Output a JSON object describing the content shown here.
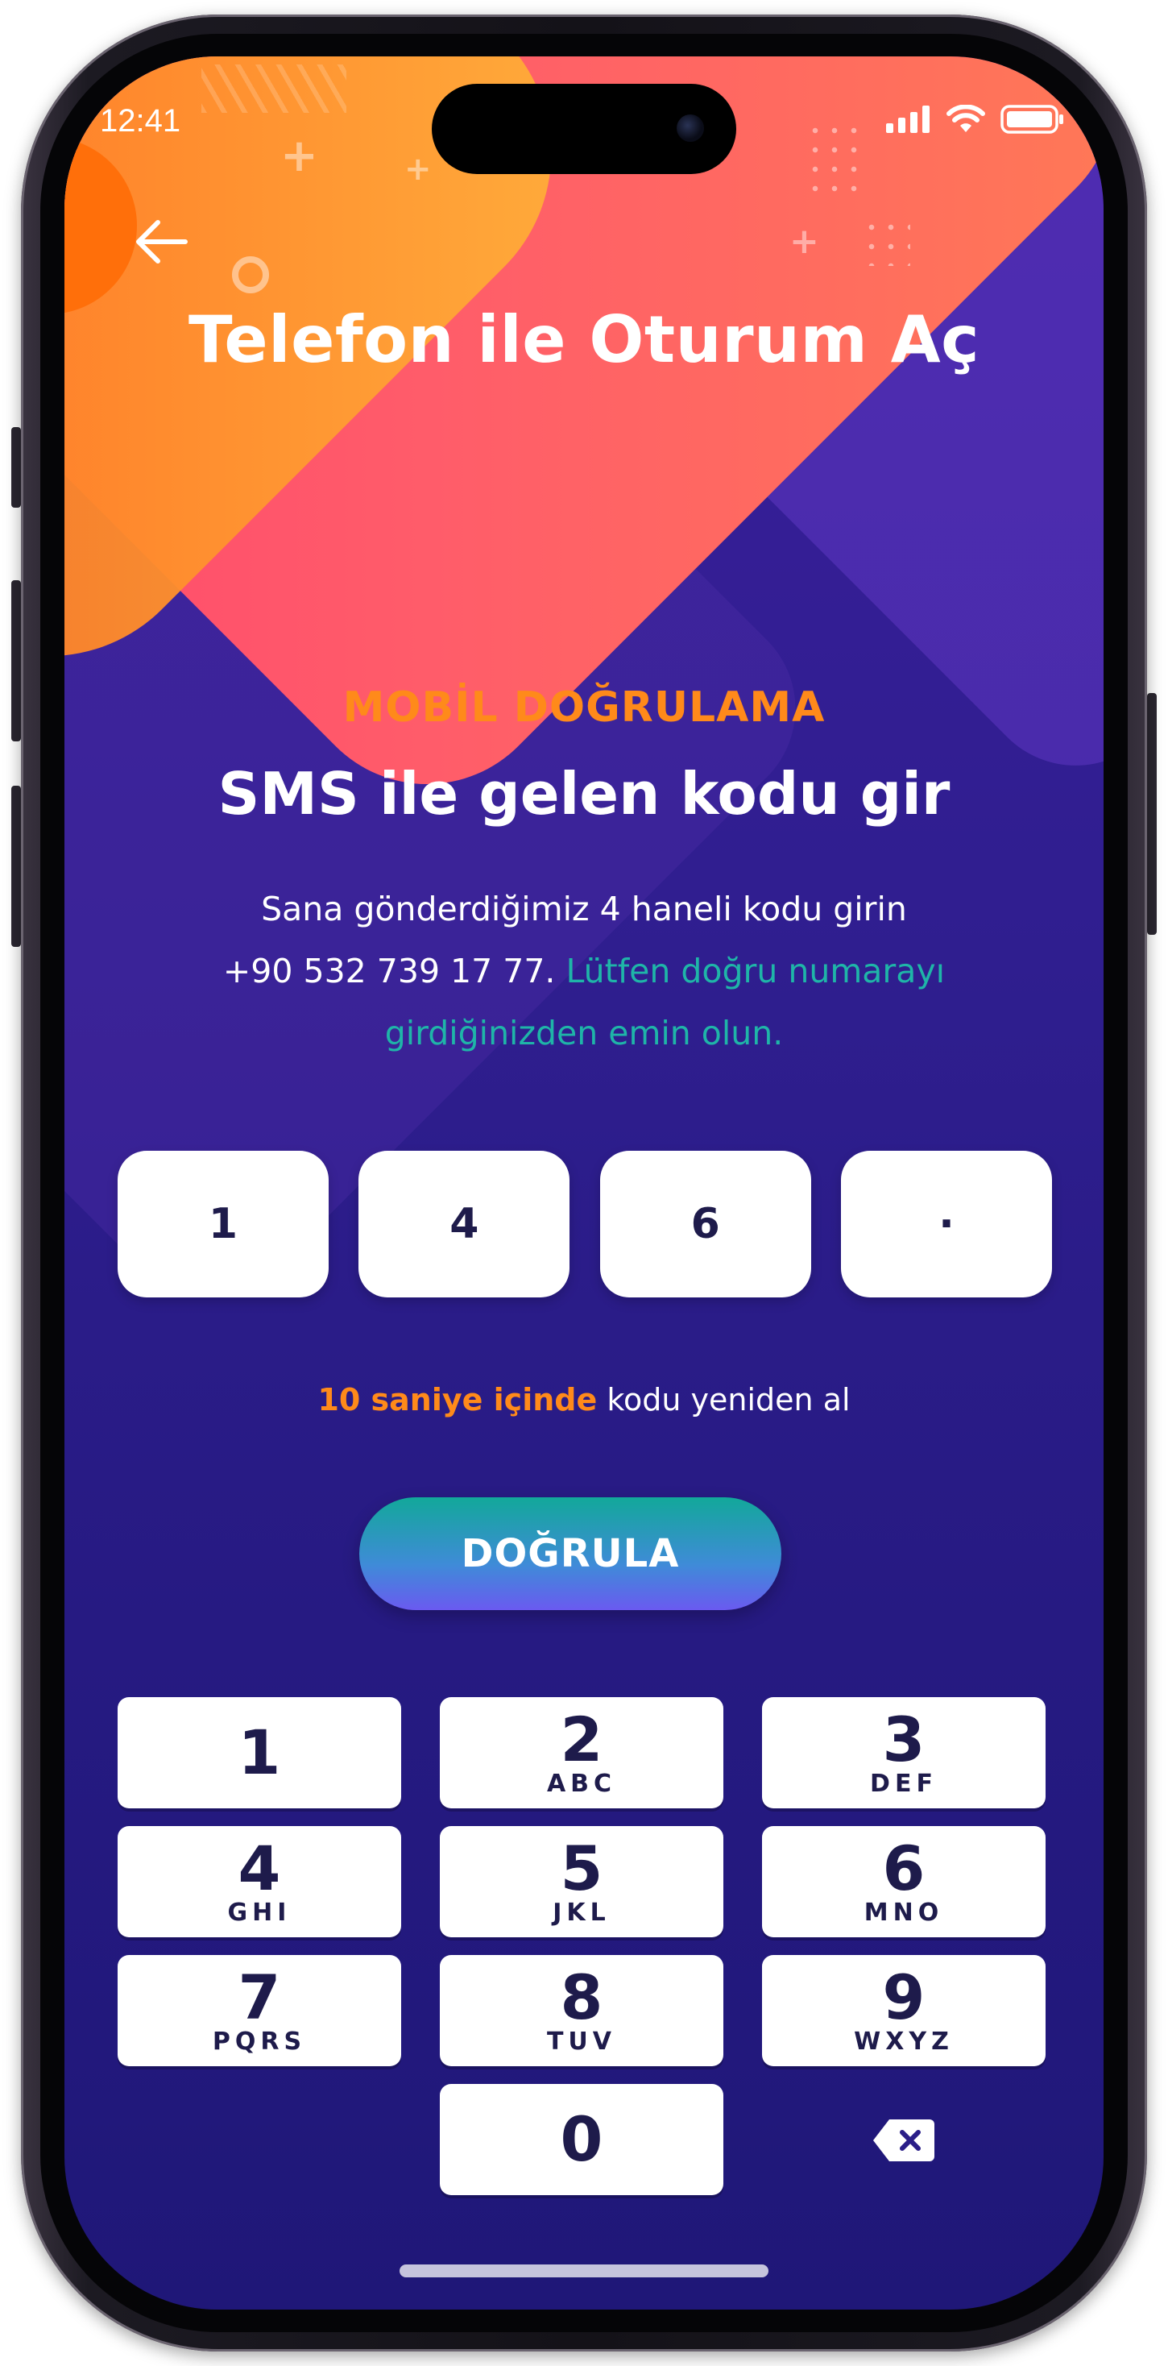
{
  "status_bar": {
    "time": "12:41"
  },
  "header": {
    "title": "Telefon ile Oturum Aç"
  },
  "verification": {
    "eyebrow": "MOBİL DOĞRULAMA",
    "heading": "SMS ile gelen kodu gir",
    "desc_line1": "Sana gönderdiğimiz 4 haneli kodu girin",
    "desc_phone": "+90 532 739 17 77.",
    "desc_accent_a": "Lütfen doğru numarayı",
    "desc_accent_b": "girdiğinizden emin olun."
  },
  "otp": {
    "digits": [
      "1",
      "4",
      "6",
      "·"
    ]
  },
  "resend": {
    "highlight": "10 saniye içinde",
    "rest": "kodu yeniden al"
  },
  "verify_button": {
    "label": "DOĞRULA"
  },
  "keypad": {
    "keys": [
      {
        "digit": "1",
        "letters": ""
      },
      {
        "digit": "2",
        "letters": "ABC"
      },
      {
        "digit": "3",
        "letters": "DEF"
      },
      {
        "digit": "4",
        "letters": "GHI"
      },
      {
        "digit": "5",
        "letters": "JKL"
      },
      {
        "digit": "6",
        "letters": "MNO"
      },
      {
        "digit": "7",
        "letters": "PQRS"
      },
      {
        "digit": "8",
        "letters": "TUV"
      },
      {
        "digit": "9",
        "letters": "WXYZ"
      },
      {
        "digit": "0",
        "letters": ""
      }
    ]
  },
  "icons": {
    "back": "arrow-left-icon",
    "delete": "backspace-icon",
    "signal": "cellular-signal-icon",
    "wifi": "wifi-icon",
    "battery": "battery-icon"
  },
  "colors": {
    "accent_orange": "#ff8a1a",
    "accent_teal": "#1fb5a8",
    "background": "#2f1e8f",
    "key_text": "#1e1b4b"
  }
}
